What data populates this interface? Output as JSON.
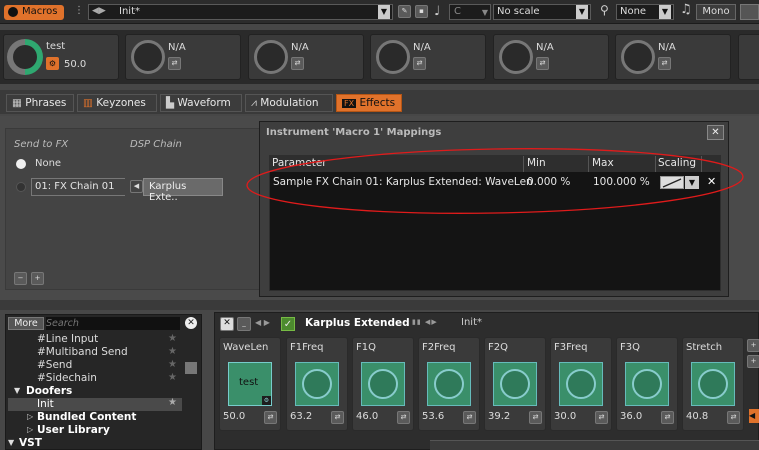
{
  "topbar": {
    "macros_label": "Macros",
    "preset_name": "Init*",
    "key_value": "C",
    "scale_value": "No scale",
    "none_value": "None",
    "mono_label": "Mono"
  },
  "macros": {
    "first_name": "test",
    "first_value": "50.0",
    "others": [
      "N/A",
      "N/A",
      "N/A",
      "N/A",
      "N/A"
    ]
  },
  "tabs": [
    "Phrases",
    "Keyzones",
    "Waveform",
    "Modulation",
    "FX Effects"
  ],
  "tabs_display": {
    "phrases": "Phrases",
    "keyzones": "Keyzones",
    "waveform": "Waveform",
    "modulation": "Modulation",
    "fx": "FX",
    "effects": "Effects"
  },
  "fx": {
    "send_header": "Send to FX",
    "dsp_header": "DSP Chain",
    "none_option": "None",
    "chain_option": "01: FX Chain 01",
    "device": "Karplus Exte..",
    "minus": "−",
    "plus": "+"
  },
  "dialog": {
    "title": "Instrument 'Macro 1' Mappings",
    "columns": {
      "parameter": "Parameter",
      "min": "Min",
      "max": "Max",
      "scaling": "Scaling"
    },
    "row": {
      "parameter": "Sample FX Chain 01: Karplus Extended: WaveLen",
      "min": "0.000 %",
      "max": "100.000 %"
    }
  },
  "browser": {
    "more": "More",
    "search_placeholder": "Search",
    "items": [
      "#Line Input",
      "#Multiband Send",
      "#Send",
      "#Sidechain"
    ],
    "doofers": "Doofers",
    "init": "Init",
    "bundled": "Bundled Content",
    "user_lib": "User Library",
    "vst": "VST"
  },
  "device": {
    "name": "Karplus Extended",
    "preset": "Init*",
    "modules": [
      {
        "name": "WaveLen",
        "value": "50.0",
        "inner": "test"
      },
      {
        "name": "F1Freq",
        "value": "63.2"
      },
      {
        "name": "F1Q",
        "value": "46.0"
      },
      {
        "name": "F2Freq",
        "value": "53.6"
      },
      {
        "name": "F2Q",
        "value": "39.2"
      },
      {
        "name": "F3Freq",
        "value": "30.0"
      },
      {
        "name": "F3Q",
        "value": "36.0"
      },
      {
        "name": "Stretch",
        "value": "40.8"
      }
    ]
  },
  "colors": {
    "accent": "#e0722b",
    "annotation": "#e01b1b",
    "knob_green": "#3a8f6a"
  }
}
